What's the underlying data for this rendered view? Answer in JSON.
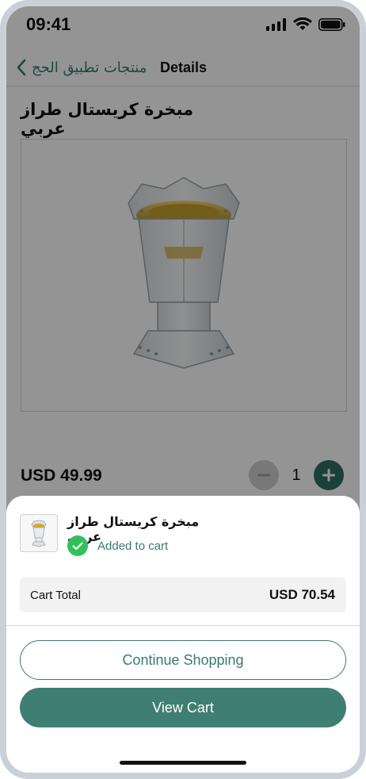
{
  "status": {
    "time": "09:41"
  },
  "nav": {
    "back_label": "منتجات تطبيق الحج",
    "title": "Details"
  },
  "product": {
    "title": "مبخرة كريستال طراز عربي",
    "price": "USD 49.99",
    "quantity": "1"
  },
  "sheet": {
    "title": "مبخرة كريستال طراز عربي",
    "added_label": "Added to cart",
    "cart_total_label": "Cart Total",
    "cart_total_value": "USD 70.54",
    "continue_label": "Continue Shopping",
    "view_cart_label": "View Cart"
  },
  "colors": {
    "brand": "#3f7f73",
    "success": "#33c05a"
  }
}
